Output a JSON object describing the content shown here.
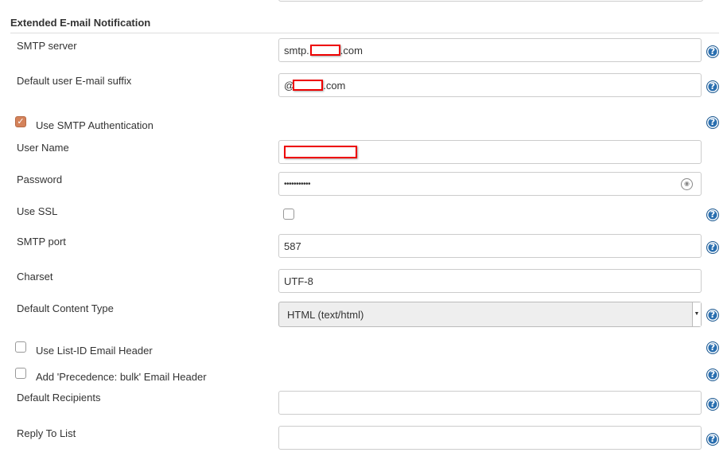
{
  "section": {
    "title": "Extended E-mail Notification"
  },
  "smtp_server": {
    "label": "SMTP server",
    "value_prefix": "smtp.",
    "value_suffix": ".com"
  },
  "default_suffix": {
    "label": "Default user E-mail suffix",
    "value_prefix": "@",
    "value_suffix": ".com"
  },
  "use_smtp_auth": {
    "label": "Use SMTP Authentication",
    "checked": true
  },
  "user_name": {
    "label": "User Name",
    "value": ""
  },
  "password": {
    "label": "Password",
    "value": "•••••••••••"
  },
  "use_ssl": {
    "label": "Use SSL",
    "checked": false
  },
  "smtp_port": {
    "label": "SMTP port",
    "value": "587"
  },
  "charset": {
    "label": "Charset",
    "value": "UTF-8"
  },
  "content_type": {
    "label": "Default Content Type",
    "value": "HTML (text/html)"
  },
  "list_id_header": {
    "label": "Use List-ID Email Header",
    "checked": false
  },
  "precedence_header": {
    "label": "Add 'Precedence: bulk' Email Header",
    "checked": false
  },
  "default_recipients": {
    "label": "Default Recipients",
    "value": ""
  },
  "reply_to": {
    "label": "Reply To List",
    "value": ""
  },
  "help": {
    "glyph": "?"
  },
  "colors": {
    "checkbox_checked": "#d4825a",
    "help_icon": "#2a6fb0",
    "redaction": "#ee0000"
  }
}
